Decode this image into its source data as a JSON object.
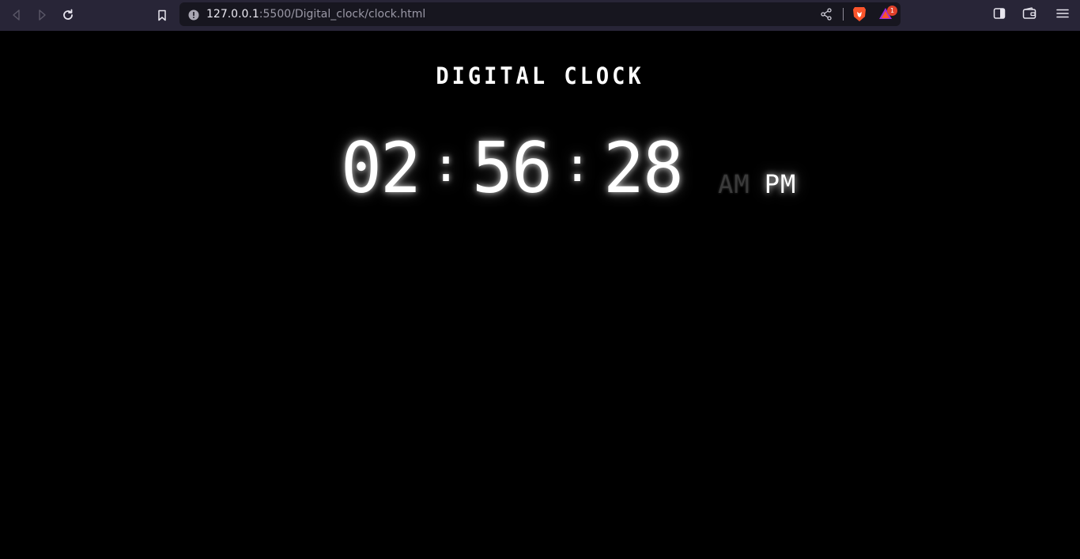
{
  "browser": {
    "url_host": "127.0.0.1",
    "url_path": ":5500/Digital_clock/clock.html",
    "rewards_badge": "1",
    "icons": {
      "back": "back-arrow-icon",
      "forward": "forward-arrow-icon",
      "reload": "reload-icon",
      "bookmark": "bookmark-icon",
      "site_info": "info-icon",
      "share": "share-icon",
      "brave": "brave-shields-icon",
      "rewards": "brave-rewards-icon",
      "sidebar": "sidebar-icon",
      "wallet": "wallet-icon",
      "menu": "hamburger-menu-icon"
    },
    "colors": {
      "toolbar": "#282537",
      "url_box": "#17161f",
      "brave_orange": "#fb542b",
      "badge": "#e0402a"
    }
  },
  "page": {
    "title": "DIGITAL CLOCK",
    "hours": "02",
    "minutes": "56",
    "seconds": "28",
    "separator": ":",
    "am_label": "AM",
    "pm_label": "PM",
    "active_period": "PM",
    "colors": {
      "background": "#000000",
      "text": "#ffffff",
      "inactive": "#3a3a3a"
    }
  }
}
